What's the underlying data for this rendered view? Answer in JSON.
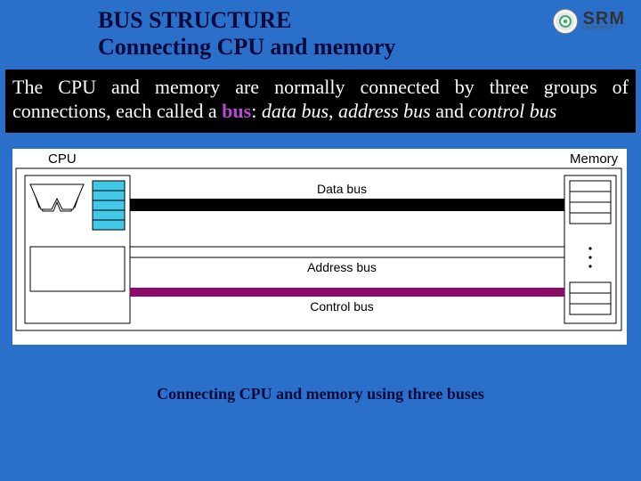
{
  "header": {
    "title_line1": "BUS STRUCTURE",
    "title_line2": "Connecting CPU and memory",
    "logo_main": "SRM",
    "logo_sub": "UNIVERSITY"
  },
  "description": {
    "prefix": "The CPU and memory are normally connected by three groups of connections, each called a ",
    "highlight": "bus",
    "after_hl": ": ",
    "it1": "data bus",
    "sep1": ", ",
    "it2": "address bus",
    "sep2": " and ",
    "it3": "control bus"
  },
  "diagram": {
    "cpu_label": "CPU",
    "memory_label": "Memory",
    "bus1": "Data bus",
    "bus2": "Address bus",
    "bus3": "Control bus"
  },
  "caption": "Connecting CPU and memory using three buses"
}
